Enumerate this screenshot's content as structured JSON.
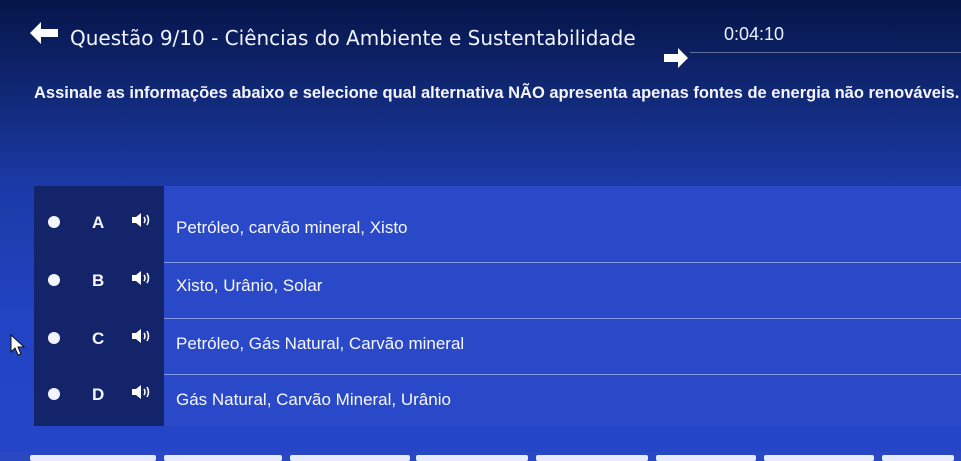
{
  "header": {
    "title": "Questão 9/10 - Ciências do Ambiente e Sustentabilidade",
    "timer": "0:04:10"
  },
  "question": {
    "text": "Assinale as informações abaixo e selecione qual alternativa NÃO apresenta apenas fontes de energia não renováveis."
  },
  "options": [
    {
      "letter": "A",
      "text": "Petróleo, carvão mineral, Xisto"
    },
    {
      "letter": "B",
      "text": "Xisto, Urânio, Solar"
    },
    {
      "letter": "C",
      "text": "Petróleo, Gás Natural, Carvão mineral"
    },
    {
      "letter": "D",
      "text": "Gás Natural, Carvão Mineral, Urânio"
    }
  ],
  "icons": {
    "back": "arrow-left-icon",
    "next": "arrow-right-icon",
    "audio": "speaker-icon",
    "cursor": "mouse-pointer-icon"
  },
  "colors": {
    "background_top": "#06154a",
    "background_bottom": "#2546c6",
    "option_left_panel": "#14246b",
    "option_right_panel": "#2a49c8",
    "text": "#ffffff"
  }
}
